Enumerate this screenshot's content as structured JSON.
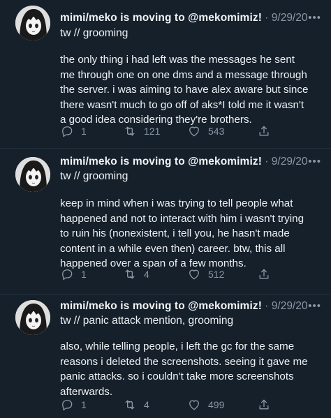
{
  "tweets": [
    {
      "author": "mimi/meko is moving to @mekomimiz!",
      "date": "9/29/20",
      "content_warning": "tw // grooming",
      "lines": [
        "the only thing i had left was the messages he sent",
        "me through one on one dms and a message through",
        "the server. i was aiming to have alex aware but since",
        "there wasn't much to go off of aks*I told me it wasn't",
        "a good idea considering they're brothers."
      ],
      "replies": "1",
      "retweets": "121",
      "likes": "543"
    },
    {
      "author": "mimi/meko is moving to @mekomimiz!",
      "date": "9/29/20",
      "content_warning": "tw // grooming",
      "lines": [
        "keep in mind when i was trying to tell people what",
        "happened and not to interact with him i wasn't trying",
        "to ruin his (nonexistent, i tell you, he hasn't made",
        "content in a while even then) career. btw, this all",
        "happened over a span of a few months."
      ],
      "replies": "1",
      "retweets": "4",
      "likes": "512"
    },
    {
      "author": "mimi/meko is moving to @mekomimiz!",
      "date": "9/29/20",
      "content_warning": "tw // panic attack mention, grooming",
      "lines": [
        "also, while telling people, i left the gc for the same",
        "reasons i deleted the screenshots. seeing it gave me",
        "panic attacks. so i couldn't take more screenshots",
        "afterwards."
      ],
      "replies": "1",
      "retweets": "4",
      "likes": "499"
    }
  ],
  "separator": "·",
  "more_glyph": "•••",
  "icons": [
    "avatar",
    "reply-icon",
    "retweet-icon",
    "like-icon",
    "share-icon"
  ],
  "colors": {
    "background": "#15202b",
    "text": "#eef1f3",
    "muted": "#8b98a5"
  }
}
